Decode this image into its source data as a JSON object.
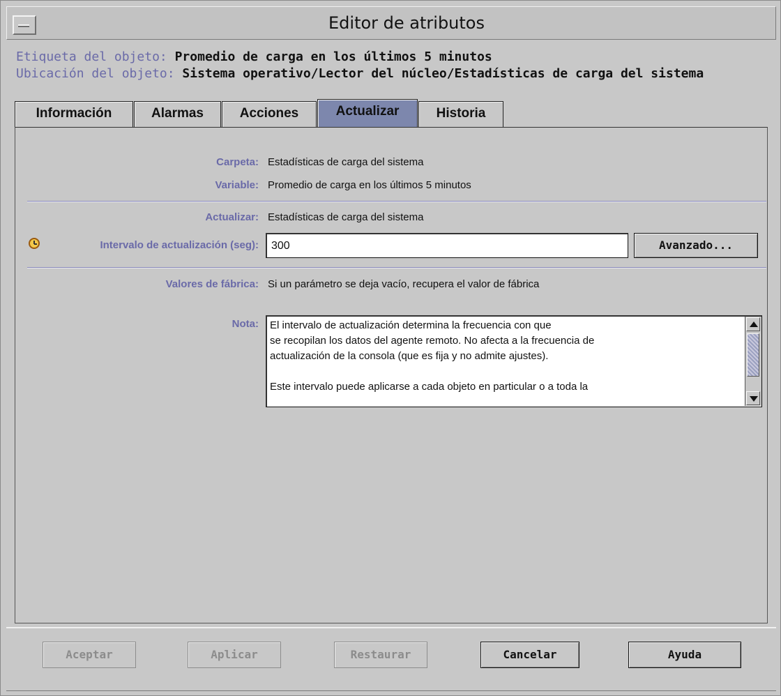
{
  "window": {
    "title": "Editor de atributos"
  },
  "header": {
    "label_caption": "Etiqueta del objeto:",
    "label_value": "Promedio de carga en los últimos 5 minutos",
    "location_caption": "Ubicación del objeto:",
    "location_value": "Sistema operativo/Lector del núcleo/Estadísticas de carga del sistema"
  },
  "tabs": [
    {
      "label": "Información"
    },
    {
      "label": "Alarmas"
    },
    {
      "label": "Acciones"
    },
    {
      "label": "Actualizar",
      "active": true
    },
    {
      "label": "Historia"
    }
  ],
  "panel": {
    "folder_label": "Carpeta:",
    "folder_value": "Estadísticas de carga del sistema",
    "variable_label": "Variable:",
    "variable_value": "Promedio de carga en los últimos 5 minutos",
    "refresh_label": "Actualizar:",
    "refresh_value": "Estadísticas de carga del sistema",
    "interval_label": "Intervalo de actualización (seg):",
    "interval_value": "300",
    "advanced_button": "Avanzado...",
    "defaults_label": "Valores de fábrica:",
    "defaults_value": "Si un parámetro se deja vacío, recupera el valor de fábrica",
    "note_label": "Nota:",
    "note_text": "El intervalo de actualización determina la frecuencia con que\nse recopilan los datos del agente remoto. No afecta a la frecuencia de\nactualización de la consola (que es fija y no admite ajustes).\n\nEste intervalo puede aplicarse a cada objeto en particular o a toda la"
  },
  "buttons": {
    "ok": "Aceptar",
    "apply": "Aplicar",
    "reset": "Restaurar",
    "cancel": "Cancelar",
    "help": "Ayuda"
  },
  "colors": {
    "label_blue": "#6a6aa8",
    "active_tab": "#7d87ad",
    "background": "#c8c8c8"
  }
}
